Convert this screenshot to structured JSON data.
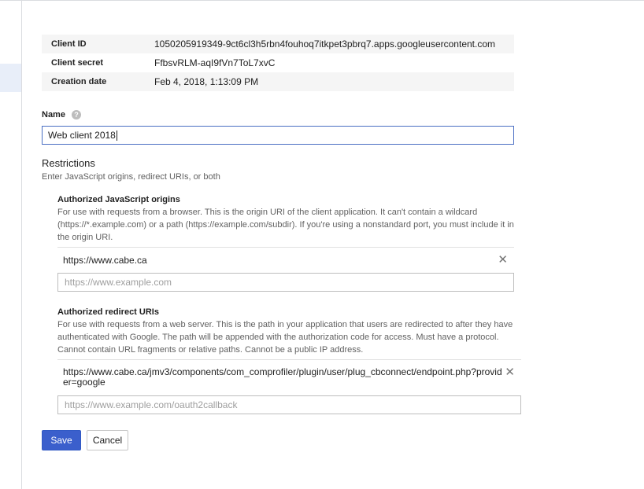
{
  "client_info": {
    "rows": [
      {
        "key": "Client ID",
        "value": "1050205919349-9ct6cl3h5rbn4fouhoq7itkpet3pbrq7.apps.googleusercontent.com"
      },
      {
        "key": "Client secret",
        "value": "FfbsvRLM-aqI9fVn7ToL7xvC"
      },
      {
        "key": "Creation date",
        "value": "Feb 4, 2018, 1:13:09 PM"
      }
    ]
  },
  "name_field": {
    "label": "Name",
    "help_icon": "?",
    "value": "Web client 2018"
  },
  "restrictions": {
    "title": "Restrictions",
    "subtitle": "Enter JavaScript origins, redirect URIs, or both"
  },
  "js_origins": {
    "title": "Authorized JavaScript origins",
    "description": "For use with requests from a browser. This is the origin URI of the client application. It can't contain a wildcard (https://*.example.com) or a path (https://example.com/subdir). If you're using a nonstandard port, you must include it in the origin URI.",
    "entries": [
      "https://www.cabe.ca"
    ],
    "placeholder": "https://www.example.com"
  },
  "redirect_uris": {
    "title": "Authorized redirect URIs",
    "description": "For use with requests from a web server. This is the path in your application that users are redirected to after they have authenticated with Google. The path will be appended with the authorization code for access. Must have a protocol. Cannot contain URL fragments or relative paths. Cannot be a public IP address.",
    "entries": [
      "https://www.cabe.ca/jmv3/components/com_comprofiler/plugin/user/plug_cbconnect/endpoint.php?provider=google"
    ],
    "placeholder": "https://www.example.com/oauth2callback"
  },
  "actions": {
    "save_label": "Save",
    "cancel_label": "Cancel"
  },
  "remove_glyph": "✕",
  "colors": {
    "primary": "#3b5fcc",
    "focus_border": "#4a6fc3"
  }
}
